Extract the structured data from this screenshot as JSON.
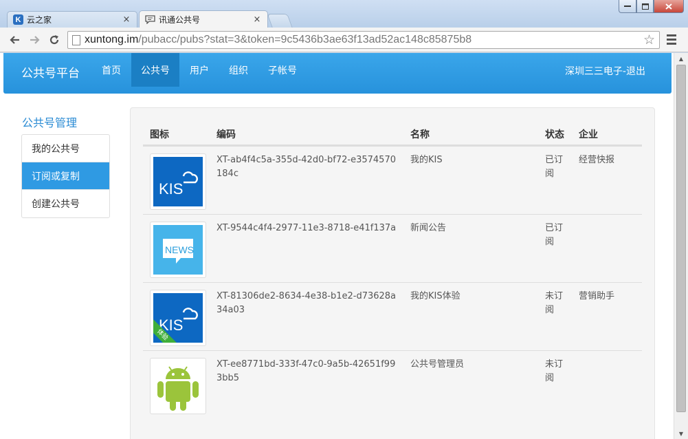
{
  "browser": {
    "tabs": [
      {
        "label": "云之家",
        "active": false
      },
      {
        "label": "讯通公共号",
        "active": true
      }
    ],
    "url_host": "xuntong.im",
    "url_rest": "/pubacc/pubs?stat=3&token=9c5436b3ae63f13ad52ac148c85875b8",
    "close_glyph": "×"
  },
  "navbar": {
    "brand": "公共号平台",
    "items": [
      "首页",
      "公共号",
      "用户",
      "组织",
      "子帐号"
    ],
    "active_index": 1,
    "user": "深圳三三电子-退出"
  },
  "sidebar": {
    "title": "公共号管理",
    "items": [
      "我的公共号",
      "订阅或复制",
      "创建公共号"
    ],
    "active_index": 1
  },
  "table": {
    "headers": [
      "图标",
      "编码",
      "名称",
      "状态",
      "企业"
    ],
    "rows": [
      {
        "icon": "kis-icon",
        "code": "XT-ab4f4c5a-355d-42d0-bf72-e3574570184c",
        "name": "我的KIS",
        "status": "已订阅",
        "org": "经营快报"
      },
      {
        "icon": "news-icon",
        "code": "XT-9544c4f4-2977-11e3-8718-e41f137a",
        "name": "新闻公告",
        "status": "已订阅",
        "org": ""
      },
      {
        "icon": "kis-trial-icon",
        "code": "XT-81306de2-8634-4e38-b1e2-d73628a34a03",
        "name": "我的KIS体验",
        "status": "未订阅",
        "org": "营销助手"
      },
      {
        "icon": "android-icon",
        "code": "XT-ee8771bd-333f-47c0-9a5b-42651f993bb5",
        "name": "公共号管理员",
        "status": "未订阅",
        "org": ""
      }
    ],
    "icon_texts": {
      "kis": "KIS",
      "news": "NEWS",
      "trial": "体验"
    }
  },
  "colors": {
    "accent": "#2f9ae3",
    "navbar": "#2792dc",
    "kis_blue": "#0d68c2",
    "news_blue": "#46b4ea",
    "android_green": "#9bc43b"
  }
}
